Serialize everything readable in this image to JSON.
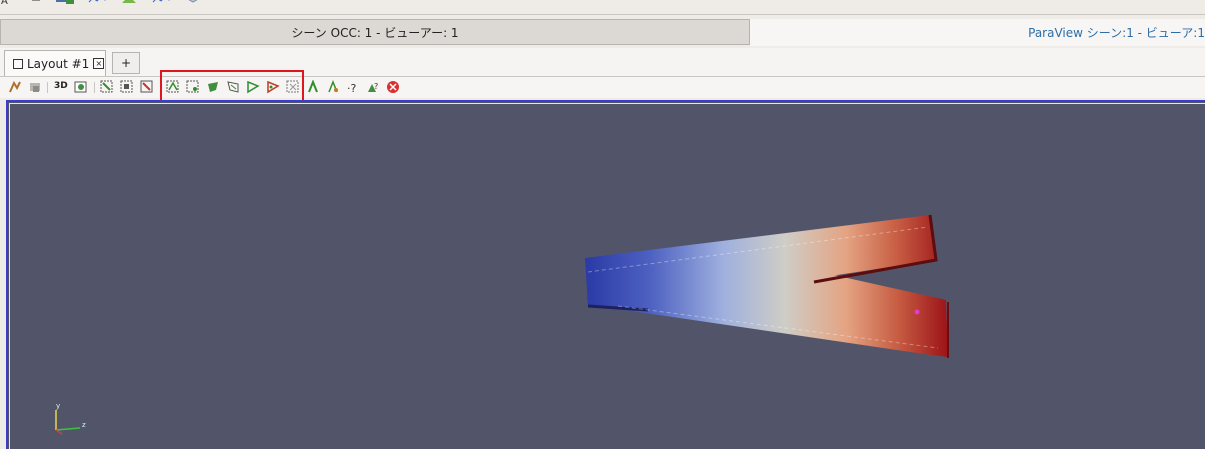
{
  "scene_tabs": [
    {
      "label": "シーン OCC: 1 - ビューアー: 1"
    },
    {
      "label": "ParaView シーン:1 - ビューア:1"
    }
  ],
  "layout": {
    "tab_label": "Layout #1",
    "add_label": "+"
  },
  "view_toolbar": {
    "mode_3d_label": "3D",
    "icons": [
      "reset-camera-icon",
      "undo-camera-icon",
      "toggle-3d-icon",
      "capture-icon",
      "select-cells-on-icon",
      "select-points-on-icon",
      "select-cells-frustum-icon",
      "select-points-frustum-icon",
      "select-cells-polygon-icon",
      "select-points-polygon-icon",
      "select-block-icon",
      "interactive-select-cells-icon",
      "interactive-select-points-icon",
      "hover-points-icon",
      "hover-cells-icon",
      "grow-selection-icon",
      "shrink-selection-icon",
      "clear-selection-icon"
    ]
  },
  "colors": {
    "accent_tab_text": "#2d6ea8",
    "viewport_bg": "#525569",
    "viewport_border": "#3a3dcf",
    "highlight_box": "#e0161e",
    "colormap_low": "#2b3aa6",
    "colormap_mid": "#c9c7c2",
    "colormap_high": "#9c1318"
  }
}
